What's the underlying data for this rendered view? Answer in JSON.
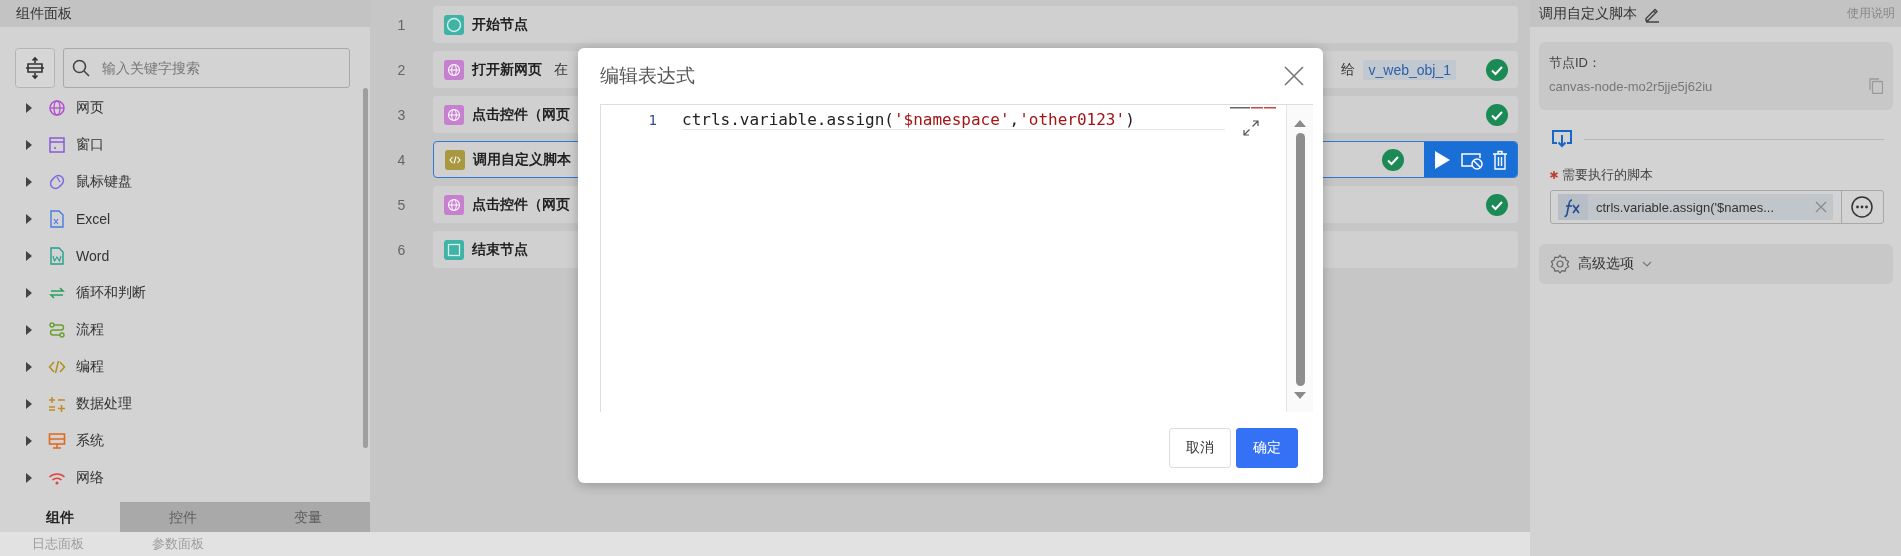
{
  "left_panel": {
    "title": "组件面板",
    "search": {
      "placeholder": "输入关键字搜索"
    },
    "tree": [
      {
        "label": "网页",
        "expanded": false
      },
      {
        "label": "窗口",
        "expanded": false
      },
      {
        "label": "鼠标键盘",
        "expanded": false
      },
      {
        "label": "Excel",
        "expanded": false
      },
      {
        "label": "Word",
        "expanded": false
      },
      {
        "label": "循环和判断",
        "expanded": false
      },
      {
        "label": "流程",
        "expanded": false
      },
      {
        "label": "编程",
        "expanded": false
      },
      {
        "label": "数据处理",
        "expanded": false
      },
      {
        "label": "系统",
        "expanded": false
      },
      {
        "label": "网络",
        "expanded": false
      }
    ],
    "tabs": [
      {
        "label": "组件",
        "selected": true
      },
      {
        "label": "控件",
        "selected": false
      },
      {
        "label": "变量",
        "selected": false
      }
    ]
  },
  "flow": {
    "rows": [
      {
        "number": "1",
        "kind": "start",
        "title": "开始节点",
        "success": false,
        "selected": false
      },
      {
        "number": "2",
        "kind": "web",
        "title": "打开新网页",
        "detail": "在",
        "assign_label": "给",
        "variable": "v_web_obj_1",
        "success": true,
        "selected": false
      },
      {
        "number": "3",
        "kind": "web",
        "title": "点击控件（网页",
        "success": true,
        "selected": false
      },
      {
        "number": "4",
        "kind": "script",
        "title": "调用自定义脚本",
        "success": true,
        "selected": true
      },
      {
        "number": "5",
        "kind": "web",
        "title": "点击控件（网页",
        "success": true,
        "selected": false
      },
      {
        "number": "6",
        "kind": "end",
        "title": "结束节点",
        "success": false,
        "selected": false
      }
    ]
  },
  "bottom_bar": {
    "tabs": [
      "日志面板",
      "参数面板"
    ]
  },
  "right_panel": {
    "title": "调用自定义脚本",
    "help_link": "使用说明",
    "node_id": {
      "label": "节点ID：",
      "value": "canvas-node-mo2r5jje5j62iu"
    },
    "script_field": {
      "label": "需要执行的脚本",
      "required": true,
      "value": "ctrls.variable.assign('$names..."
    },
    "advanced": {
      "label": "高级选项",
      "expanded": false
    }
  },
  "modal": {
    "title": "编辑表达式",
    "editor": {
      "lines": [
        {
          "number": "1",
          "code": "ctrls.variable.assign('$namespace','other0123')"
        }
      ]
    },
    "buttons": [
      {
        "label": "取消",
        "kind": "default"
      },
      {
        "label": "确定",
        "kind": "primary"
      }
    ]
  }
}
